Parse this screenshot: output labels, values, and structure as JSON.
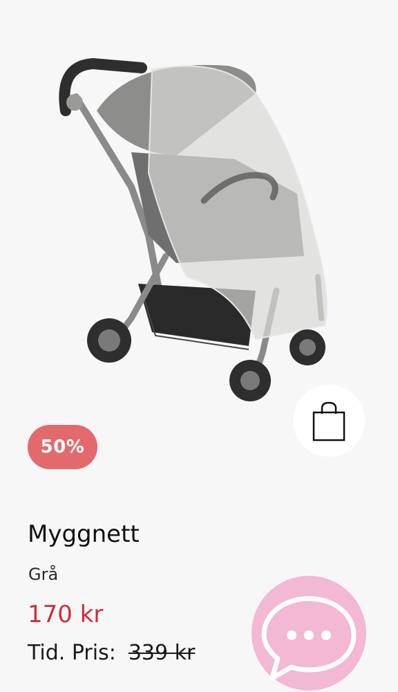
{
  "product": {
    "discount_badge": "50%",
    "title": "Myggnett",
    "variant": "Grå",
    "price": "170 kr",
    "previous_price_label": "Tid. Pris:",
    "previous_price": "339 kr",
    "image_subject": "Stroller with grey mosquito net"
  },
  "actions": {
    "cart_icon": "shopping-bag-icon",
    "chat_icon": "chat-bubble-icon"
  },
  "colors": {
    "background": "#f8f7f8",
    "badge": "#e36a6c",
    "price": "#d32b34",
    "chat_button": "#f2b8d4"
  }
}
